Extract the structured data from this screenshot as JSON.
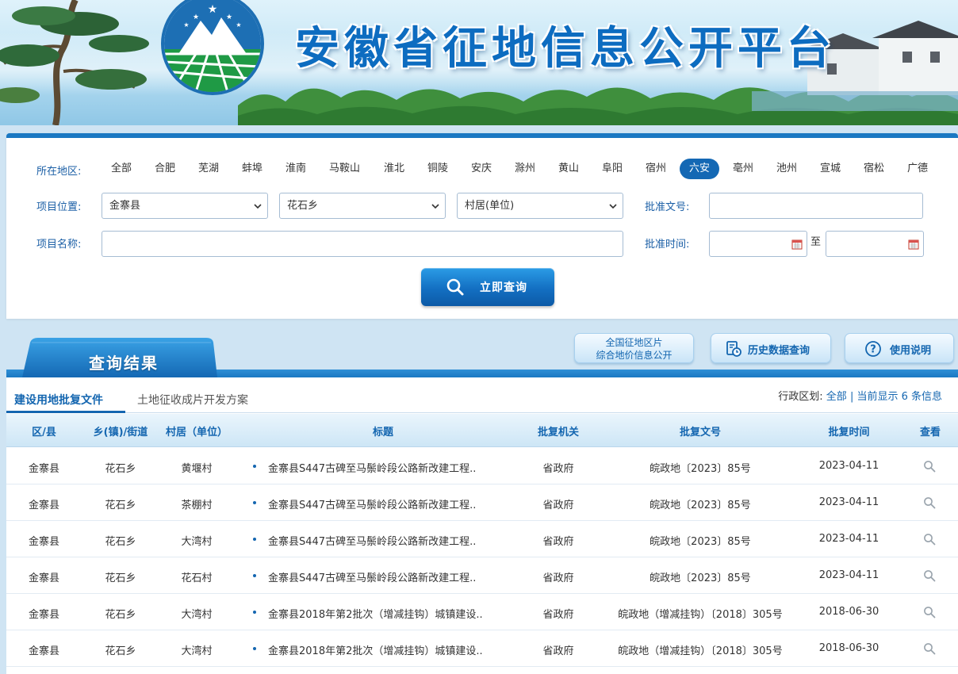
{
  "banner": {
    "title": "安徽省征地信息公开平台"
  },
  "filter": {
    "region_label": "所在地区:",
    "regions": [
      "全部",
      "合肥",
      "芜湖",
      "蚌埠",
      "淮南",
      "马鞍山",
      "淮北",
      "铜陵",
      "安庆",
      "滁州",
      "黄山",
      "阜阳",
      "宿州",
      "六安",
      "亳州",
      "池州",
      "宣城",
      "宿松",
      "广德"
    ],
    "active_region": "六安",
    "location_label": "项目位置:",
    "county": "金寨县",
    "township": "花石乡",
    "village_placeholder": "村居(单位)",
    "approval_no_label": "批准文号:",
    "project_name_label": "项目名称:",
    "approval_time_label": "批准时间:",
    "to_label": "至",
    "search_button": "立即查询"
  },
  "results": {
    "tab_title": "查询结果",
    "btn_nationwide_line1": "全国征地区片",
    "btn_nationwide_line2": "综合地价信息公开",
    "btn_history": "历史数据查询",
    "btn_help": "使用说明"
  },
  "table": {
    "tabs": [
      "建设用地批复文件",
      "土地征收成片开发方案"
    ],
    "info_prefix": "行政区划:",
    "info_region": "全部",
    "info_sep": " | ",
    "info_count": "当前显示 6 条信息",
    "headers": [
      "区/县",
      "乡(镇)/街道",
      "村居（单位）",
      "标题",
      "批复机关",
      "批复文号",
      "批复时间",
      "查看"
    ],
    "rows": [
      [
        "金寨县",
        "花石乡",
        "黄堰村",
        "金寨县S447古碑至马鬃岭段公路新改建工程..",
        "省政府",
        "皖政地〔2023〕85号",
        "2023-04-11"
      ],
      [
        "金寨县",
        "花石乡",
        "茶棚村",
        "金寨县S447古碑至马鬃岭段公路新改建工程..",
        "省政府",
        "皖政地〔2023〕85号",
        "2023-04-11"
      ],
      [
        "金寨县",
        "花石乡",
        "大湾村",
        "金寨县S447古碑至马鬃岭段公路新改建工程..",
        "省政府",
        "皖政地〔2023〕85号",
        "2023-04-11"
      ],
      [
        "金寨县",
        "花石乡",
        "花石村",
        "金寨县S447古碑至马鬃岭段公路新改建工程..",
        "省政府",
        "皖政地〔2023〕85号",
        "2023-04-11"
      ],
      [
        "金寨县",
        "花石乡",
        "大湾村",
        "金寨县2018年第2批次（增减挂钩）城镇建设..",
        "省政府",
        "皖政地（增减挂钩）〔2018〕305号",
        "2018-06-30"
      ],
      [
        "金寨县",
        "花石乡",
        "大湾村",
        "金寨县2018年第2批次（增减挂钩）城镇建设..",
        "省政府",
        "皖政地（增减挂钩）〔2018〕305号",
        "2018-06-30"
      ]
    ]
  }
}
